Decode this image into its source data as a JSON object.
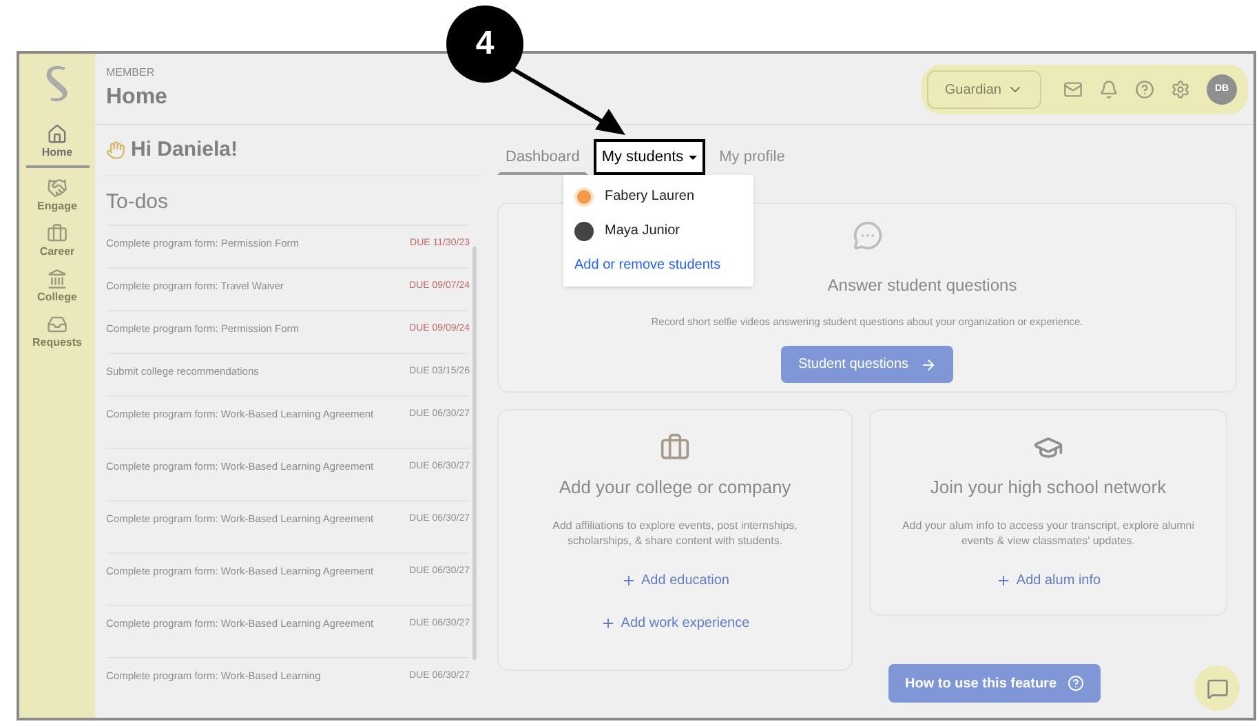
{
  "callout": {
    "number": "4"
  },
  "header": {
    "eyebrow": "MEMBER",
    "title": "Home"
  },
  "sidebar": {
    "items": [
      {
        "label": "Home",
        "selected": true
      },
      {
        "label": "Engage",
        "selected": false
      },
      {
        "label": "Career",
        "selected": false
      },
      {
        "label": "College",
        "selected": false
      },
      {
        "label": "Requests",
        "selected": false
      }
    ]
  },
  "topbar": {
    "role": "Guardian",
    "avatar": "DB"
  },
  "greeting": "Hi Daniela!",
  "todos": {
    "title": "To-dos",
    "items": [
      {
        "text": "Complete program form: Permission Form",
        "due": "DUE 11/30/23",
        "overdue": true
      },
      {
        "text": "Complete program form: Travel Waiver",
        "due": "DUE 09/07/24",
        "overdue": true
      },
      {
        "text": "Complete program form: Permission Form",
        "due": "DUE 09/09/24",
        "overdue": true
      },
      {
        "text": "Submit college recommendations",
        "due": "DUE 03/15/26",
        "overdue": false
      },
      {
        "text": "Complete program form: Work-Based Learning Agreement",
        "due": "DUE 06/30/27",
        "overdue": false
      },
      {
        "text": "Complete program form: Work-Based Learning Agreement",
        "due": "DUE 06/30/27",
        "overdue": false
      },
      {
        "text": "Complete program form: Work-Based Learning Agreement",
        "due": "DUE 06/30/27",
        "overdue": false
      },
      {
        "text": "Complete program form: Work-Based Learning Agreement",
        "due": "DUE 06/30/27",
        "overdue": false
      },
      {
        "text": "Complete program form: Work-Based Learning Agreement",
        "due": "DUE 06/30/27",
        "overdue": false
      },
      {
        "text": "Complete program form: Work-Based Learning",
        "due": "DUE 06/30/27",
        "overdue": false
      }
    ]
  },
  "tabs": [
    {
      "label": "Dashboard",
      "selected": true,
      "highlighted": false,
      "expanded": false
    },
    {
      "label": "My students",
      "selected": false,
      "highlighted": true,
      "expanded": true
    },
    {
      "label": "My profile",
      "selected": false,
      "highlighted": false,
      "expanded": false
    }
  ],
  "dropdown": {
    "students": [
      {
        "name": "Fabery Lauren",
        "kind": "emoji"
      },
      {
        "name": "Maya Junior",
        "kind": "photo"
      }
    ],
    "link": "Add or remove students"
  },
  "questions_card": {
    "title": "Answer student questions",
    "text": "Record short selfie videos answering student questions about your organization or experience.",
    "button": "Student questions"
  },
  "college_card": {
    "title": "Add your college or company",
    "text": "Add affiliations to explore events, post internships, scholarships, & share content with students.",
    "actions": [
      "Add education",
      "Add work experience"
    ]
  },
  "network_card": {
    "title": "Join your high school network",
    "text": "Add your alum info to access your transcript, explore alumni events & view classmates' updates.",
    "actions": [
      "Add alum info"
    ]
  },
  "help_button": "How to use this feature"
}
